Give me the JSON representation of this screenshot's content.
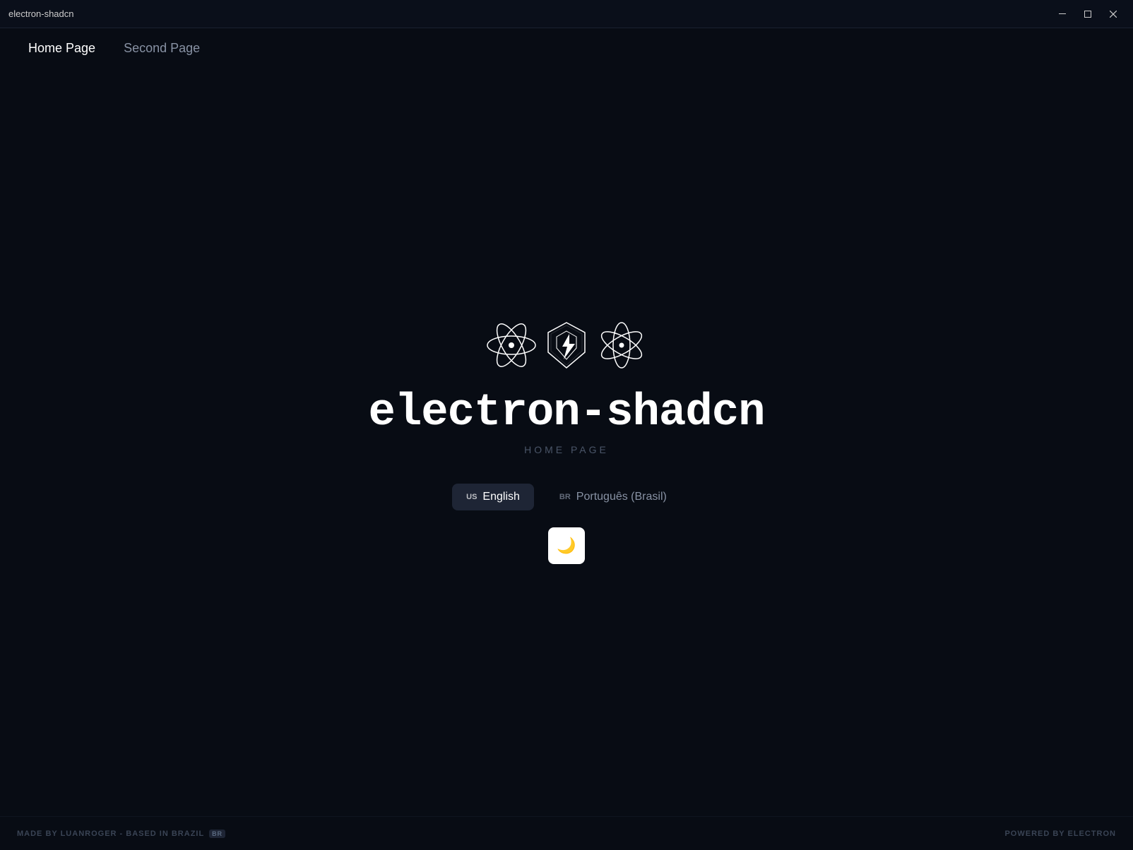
{
  "titlebar": {
    "title": "electron-shadcn",
    "minimize_label": "minimize",
    "maximize_label": "maximize",
    "close_label": "close"
  },
  "navbar": {
    "items": [
      {
        "id": "home",
        "label": "Home Page",
        "active": true
      },
      {
        "id": "second",
        "label": "Second Page",
        "active": false
      }
    ]
  },
  "main": {
    "app_name": "electron-shadcn",
    "subtitle": "HOME PAGE",
    "lang_buttons": [
      {
        "id": "en",
        "prefix": "US",
        "label": "English",
        "active": true
      },
      {
        "id": "pt",
        "prefix": "BR",
        "label": "Português (Brasil)",
        "active": false
      }
    ],
    "theme_toggle_icon": "🌙"
  },
  "footer": {
    "left_text": "MADE BY LUANROGER - BASED IN BRAZIL",
    "left_badge": "BR",
    "right_text": "POWERED BY ELECTRON"
  }
}
